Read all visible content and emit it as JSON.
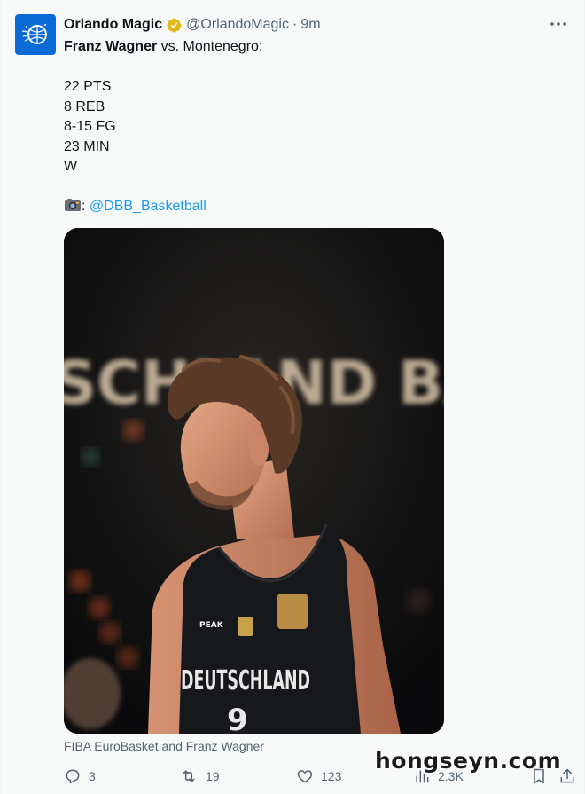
{
  "author": {
    "display_name": "Orlando Magic",
    "handle": "@OrlandoMagic",
    "separator": "·",
    "time": "9m"
  },
  "tweet": {
    "line1_bold": "Franz Wagner",
    "line1_rest": " vs. Montenegro:",
    "stats": [
      "22 PTS",
      "8 REB",
      "8-15 FG",
      "23 MIN",
      "W"
    ],
    "credit_prefix": ":",
    "credit_link": "@DBB_Basketball"
  },
  "media": {
    "background_text": "SCHLAND BASK",
    "jersey_text": "DEUTSCHLAND",
    "jersey_brand": "PEAK",
    "jersey_number": "9",
    "caption": "FIBA EuroBasket and Franz Wagner"
  },
  "actions": {
    "replies": "3",
    "retweets": "19",
    "likes": "123",
    "views": "2.3K"
  },
  "watermark": "hongseyn.com",
  "colors": {
    "link": "#1d9bf0",
    "secondary_text": "#536471",
    "verified_gold": "#e2b719",
    "avatar_blue": "#0b6bd6"
  },
  "icons": [
    "verified-badge-icon",
    "more-icon",
    "camera-icon",
    "reply-icon",
    "retweet-icon",
    "like-icon",
    "views-icon",
    "bookmark-icon",
    "share-icon"
  ]
}
